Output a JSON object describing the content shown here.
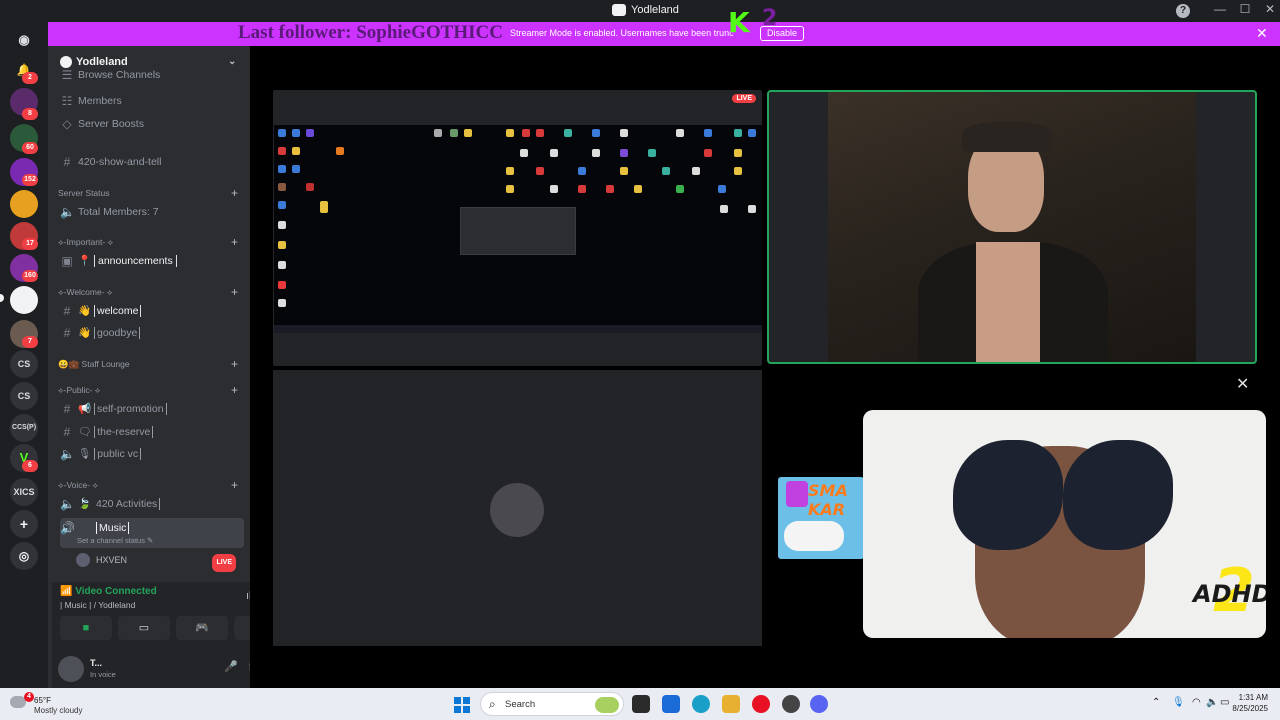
{
  "window": {
    "title": "Yodleland"
  },
  "banner": {
    "last_follower": "Last follower: SophieGOTHICC",
    "message": "Streamer Mode is enabled. Usernames have been trunc",
    "disable_label": "Disable",
    "overlay_logo": "K",
    "overlay_logo2": "2"
  },
  "rail": {
    "badges": [
      "2",
      "8",
      "60",
      "152",
      "17",
      "160",
      "7",
      "6"
    ],
    "labels": [
      "CS",
      "CS",
      "CCS(P)",
      "XICS"
    ]
  },
  "server": {
    "name": "Yodleland"
  },
  "channels": {
    "browse": "Browse Channels",
    "members": "Members",
    "boosts": "Server Boosts",
    "show_and_tell": "420-show-and-tell",
    "server_status_cat": "Server Status",
    "total_members": "Total Members: 7",
    "important_cat": "⟡-Important- ⟡",
    "announcements": "announcements",
    "welcome_cat": "⟡-Welcome- ⟡",
    "welcome": "welcome",
    "goodbye": "goodbye",
    "staff_lounge": "Staff Lounge",
    "public_cat": "⟡-Public- ⟡",
    "self_promotion": "self-promotion",
    "the_reserve": "the-reserve",
    "public_vc": "public vc",
    "voice_cat": "⟡-Voice- ⟡",
    "activities": "420 Activities",
    "music": "Music",
    "set_status": "Set a channel status"
  },
  "voice_users": [
    {
      "name": "HXVEN",
      "live": "LIVE"
    }
  ],
  "voice_panel": {
    "status": "Video Connected",
    "location": "| Music | / Yodleland"
  },
  "user": {
    "name": "T...",
    "status": "In voice"
  },
  "stage": {
    "live_label": "LIVE"
  },
  "taskbar": {
    "temp": "65°F",
    "weather": "Mostly cloudy",
    "weather_badge": "4",
    "search_placeholder": "Search",
    "time": "1:31 AM",
    "date": "8/25/2025"
  },
  "album": {
    "title": "ADHD",
    "number": "2"
  },
  "game": {
    "title": "SMA KAR"
  },
  "colors": {
    "accent": "#cc33ff",
    "connected": "#23a55a",
    "live": "#f23f43"
  }
}
